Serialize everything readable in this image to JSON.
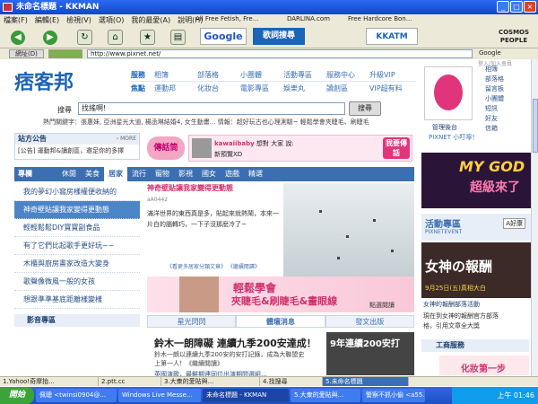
{
  "window": {
    "title": "未命名標題 - KKMAN",
    "controls": [
      "_",
      "□",
      "×"
    ]
  },
  "menubar": {
    "items": [
      "檔案(F)",
      "編輯(E)",
      "檢視(V)",
      "選項(O)",
      "我的最愛(A)",
      "說明(H)"
    ]
  },
  "bookmarks": [
    "All Free Fetish, Fre...",
    "DARLINA.com",
    "Free Hardcore Bon..."
  ],
  "toolbar": {
    "google_label": "Google",
    "search_button_label": "歌詞搜尋",
    "brand_label": "KKATM",
    "corner_badge": "COSMOS PEOPLE"
  },
  "addressbar": {
    "label": "網址(D)",
    "url": "http://www.pixnet.net/",
    "search_engine": "Google"
  },
  "site": {
    "logo": "痞客邦",
    "nav": {
      "row1_cat": "服務",
      "row1": [
        "相簿",
        "部落格",
        "小團體",
        "活動專區",
        "服務中心",
        "升級VIP"
      ],
      "row2_cat": "焦點",
      "row2": [
        "運動邦",
        "化妝台",
        "電影專區",
        "娛樂丸",
        "讀創區",
        "VIP超有料"
      ]
    },
    "search": {
      "label": "搜尋",
      "input_value": "找搖啊!",
      "button_label": "搜尋"
    },
    "hot_words": "熱門關鍵字：張惠妹, 亞洲星光大道, 楊丞琳結婚4, 女生動畫...     情報：超好玩古也心理測驗~     輕鬆學會夾睫毛、刷睫毛",
    "announcement": {
      "title": "站方公告",
      "more": "› MORE",
      "body": "[公告] 運動邦&讀創區，邀足你的多擇"
    },
    "message": {
      "bubble": "傳話筒",
      "user": "kawaiibaby",
      "text_prefix": "想對 大家 說:",
      "text": "新預覽XD",
      "send_button": "我要傳話"
    },
    "board": {
      "head": "專欄",
      "tabs": [
        "休閒",
        "美食",
        "居家",
        "流行",
        "寵物",
        "影視",
        "國女",
        "遊戲",
        "精選"
      ],
      "active_tab": "居家"
    },
    "left_list": [
      "我的夢幻小窩房樣權便收納的",
      "神奇壁貼讓我家變得更動態",
      "輕輕鬆鬆DIY寶寶副食品",
      "有了它們比起歌手更好玩~~",
      "木櫃與廚房畫家改造大變身",
      "歌聲像微風一般的女孩",
      "想跟準準基底距離樣變樣"
    ],
    "article": {
      "title": "神奇壁貼讓我家變得更動態",
      "meta": "aA0442",
      "body": "滿洋世界的東西真是多，貼起來就熱鬧，本來一片白的腦轉巧，一下子沒那麼冷了~",
      "link": "《看更多居家分類文章》 《繼續閱讀》"
    },
    "ad_banner": {
      "title": "輕鬆學會",
      "subtitle": "夾睫毛&刷睫毛&畫眼線",
      "link": "點選閱讀"
    },
    "media_head": "影音專區",
    "subtabs": [
      "星光閃閃",
      "體壇消息",
      "發文出版"
    ],
    "active_subtab": "體壇消息",
    "lower_story": {
      "headline": "鈴木一朗障礙 連續九季200安達成！",
      "text": "鈴木一朗以連續九季200安的安打記錄，成為大聯盟史上第一人！《繼續閱讀》",
      "sub": "英國演歌，最鮮期連同位出演期間選組...",
      "image_text": "9年連續200安打"
    },
    "right": {
      "login": "登入/加入會員",
      "links": [
        "相簿",
        "部落格",
        "留言板",
        "小團體",
        "短訊",
        "好友",
        "信箱"
      ],
      "manage": "管理後台",
      "pixnet_brand": "PIXNET 小叮嚀！",
      "ad1_title": "MY GOD",
      "ad1_sub": "超級來了",
      "activity_title": "活動專區",
      "activity_sub": "PIXNETEVENT",
      "activity_more": "A好康",
      "ad2_title": "女神の報酬",
      "ad2_date": "9月25日(五)真相大白",
      "ad2_caption": "女神的報酬部落活動",
      "ad2_line1": "現在到女神的報酬官方部落",
      "ad2_line2": "格，引用文章全大獎",
      "service_head": "工商服務",
      "service_text": "化妝第一步"
    }
  },
  "statusbar": [
    "1.Yahoo!奇摩抬...",
    "2.ptt.cc",
    "3.大衆的愛貼與...",
    "4.找搜尋",
    "5.未命名標題"
  ],
  "taskbar": {
    "start": "開始",
    "tasks": [
      "佩聰 <twinsi0904@...",
      "Windows Live Messe...",
      "未命名標題 - KKMAN",
      "5.大衆的愛貼與...",
      "警察不抓小偷 <a55..."
    ],
    "active_task": "未命名標題 - KKMAN",
    "clock": "上午 01:46"
  }
}
